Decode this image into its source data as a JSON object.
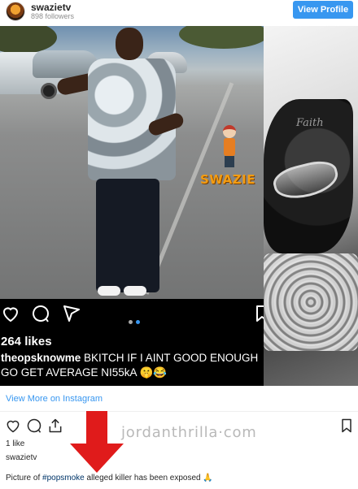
{
  "header": {
    "username": "swazietv",
    "followers": "898 followers",
    "view_profile_label": "View Profile"
  },
  "media": {
    "left_watermark": "SWAZIE",
    "tattoo_text": "Faith",
    "carousel_dots": 2,
    "active_dot": 2,
    "dark_overlay": {
      "likes": "264 likes",
      "caption_user": "theopsknowme",
      "caption_text": "BKITCH IF I AINT GOOD ENOUGH GO GET AVERAGE NI55kA 🤫😂"
    }
  },
  "view_more_label": "View More on Instagram",
  "post": {
    "likes": "1 like",
    "owner": "swazietv",
    "caption_prefix": "Picture of ",
    "caption_hashtag": "#popsmoke",
    "caption_suffix": " alleged killer has been exposed 🙏"
  },
  "overlay_watermark": "jordanthrilla·com",
  "colors": {
    "accent_blue": "#3897f0",
    "hashtag_blue": "#003569",
    "arrow_red": "#e01b1b",
    "muted_gray": "#8e8e8e"
  },
  "icons": [
    "heart-icon",
    "comment-icon",
    "share-icon",
    "bookmark-icon"
  ]
}
